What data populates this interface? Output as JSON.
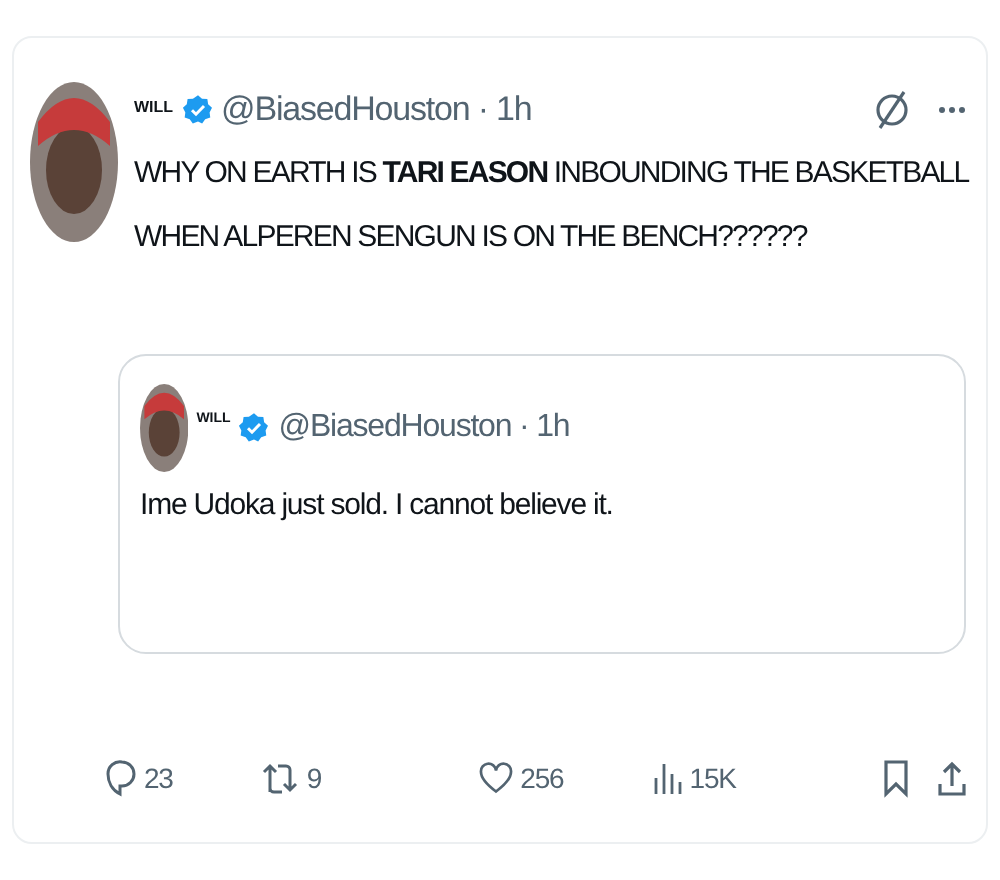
{
  "tweet": {
    "name": "WILL",
    "byline": "@BiasedHouston · 1h",
    "text": "WHY ON EARTH IS **TARI EASON** INBOUNDING THE BASKETBALL WHEN ALPEREN SENGUN IS ON THE BENCH??????"
  },
  "quote": {
    "name": "WILL",
    "byline": "@BiasedHouston · 1h",
    "text": "Ime Udoka just sold. I cannot believe it."
  },
  "actions": [
    {
      "kind": "reply",
      "count": "23"
    },
    {
      "kind": "repost",
      "count": "9"
    },
    {
      "kind": "like",
      "count": "256"
    },
    {
      "kind": "views",
      "count": "15K"
    }
  ]
}
